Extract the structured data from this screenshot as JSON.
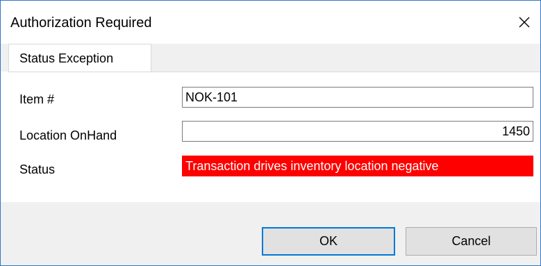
{
  "window": {
    "title": "Authorization Required"
  },
  "tabs": [
    {
      "label": "Status Exception"
    }
  ],
  "form": {
    "item": {
      "label": "Item #",
      "value": "NOK-101"
    },
    "onhand": {
      "label": "Location OnHand",
      "value": "1450"
    },
    "status": {
      "label": "Status",
      "value": "Transaction drives inventory location negative"
    }
  },
  "buttons": {
    "ok": "OK",
    "cancel": "Cancel"
  },
  "colors": {
    "status_background": "#ff0000",
    "status_text": "#ffffff",
    "ok_focus_border": "#0078d7",
    "window_border": "#2b78c8"
  },
  "icons": {
    "close": "close-icon"
  }
}
